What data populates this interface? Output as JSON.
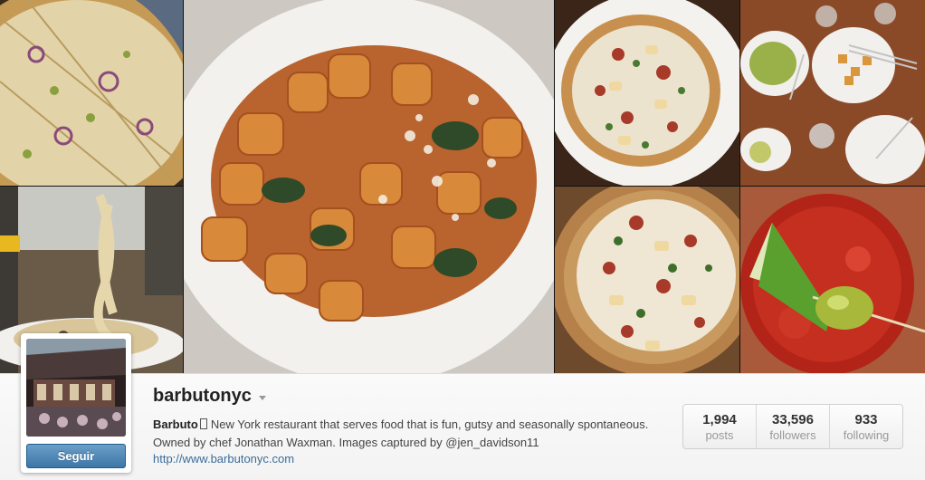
{
  "photos": [
    {
      "name": "photo-pizza-onion"
    },
    {
      "name": "photo-pasta-fork"
    },
    {
      "name": "photo-gnocchi"
    },
    {
      "name": "photo-pizza-apple"
    },
    {
      "name": "photo-table-plates"
    },
    {
      "name": "photo-pizza-board"
    },
    {
      "name": "photo-bloody-mary"
    }
  ],
  "profile": {
    "username": "barbutonyc",
    "follow_label": "Seguir",
    "bio_name": "Barbuto",
    "bio_text": "New York restaurant that serves food that is fun, gutsy and seasonally spontaneous. Owned by chef Jonathan Waxman. Images captured by @jen_davidson11",
    "website": "http://www.barbutonyc.com"
  },
  "stats": [
    {
      "value": "1,994",
      "label": "posts"
    },
    {
      "value": "33,596",
      "label": "followers"
    },
    {
      "value": "933",
      "label": "following"
    }
  ],
  "colors": {
    "follow_button": "#3d76a6",
    "link": "#3a6d99"
  }
}
